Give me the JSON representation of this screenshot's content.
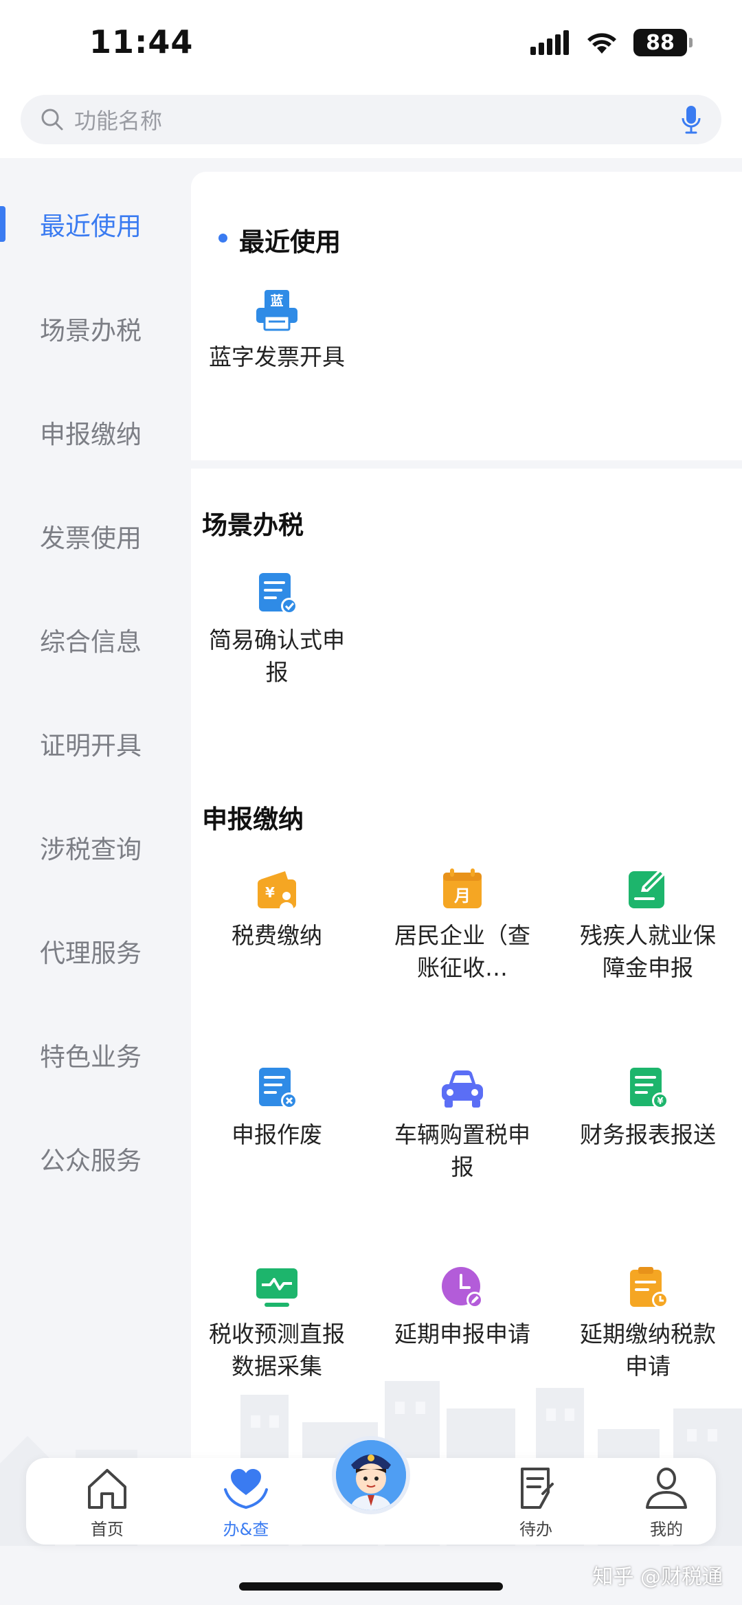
{
  "status_bar": {
    "time": "11:44",
    "battery": "88",
    "icons": [
      "signal-icon",
      "wifi-icon",
      "battery-icon"
    ]
  },
  "search": {
    "placeholder": "功能名称",
    "icons": [
      "search-icon",
      "microphone-icon"
    ]
  },
  "sidebar": {
    "active_index": 0,
    "items": [
      {
        "label": "最近使用"
      },
      {
        "label": "场景办税"
      },
      {
        "label": "申报缴纳"
      },
      {
        "label": "发票使用"
      },
      {
        "label": "综合信息"
      },
      {
        "label": "证明开具"
      },
      {
        "label": "涉税查询"
      },
      {
        "label": "代理服务"
      },
      {
        "label": "特色业务"
      },
      {
        "label": "公众服务"
      }
    ]
  },
  "sections": {
    "recent": {
      "title": "最近使用",
      "items": [
        {
          "label": "蓝字发票开具",
          "icon": "blue-invoice-printer-icon",
          "badge": "蓝",
          "color": "#2f8be6"
        }
      ]
    },
    "scene": {
      "title": "场景办税",
      "items": [
        {
          "label": "简易确认式申报",
          "icon": "document-check-icon",
          "color": "#2f8be6"
        }
      ]
    },
    "declare": {
      "title": "申报缴纳",
      "items": [
        {
          "label": "税费缴纳",
          "icon": "wallet-yen-icon",
          "color": "#f5a623"
        },
        {
          "label": "居民企业（查账征收…",
          "icon": "calendar-month-icon",
          "badge": "月",
          "color": "#f5a623"
        },
        {
          "label": "残疾人就业保障金申报",
          "icon": "document-edit-icon",
          "color": "#1db56c"
        },
        {
          "label": "申报作废",
          "icon": "document-cancel-icon",
          "color": "#2f8be6"
        },
        {
          "label": "车辆购置税申报",
          "icon": "car-icon",
          "color": "#5b6ef5"
        },
        {
          "label": "财务报表报送",
          "icon": "document-yen-icon",
          "color": "#1db56c"
        },
        {
          "label": "税收预测直报数据采集",
          "icon": "monitor-chart-icon",
          "color": "#1db56c"
        },
        {
          "label": "延期申报申请",
          "icon": "clock-edit-icon",
          "color": "#b35cd9"
        },
        {
          "label": "延期缴纳税款申请",
          "icon": "clipboard-clock-icon",
          "color": "#f5a623"
        }
      ]
    }
  },
  "tabbar": {
    "active_index": 1,
    "items": [
      {
        "label": "首页",
        "icon": "home-icon"
      },
      {
        "label": "办&查",
        "icon": "heart-hands-icon"
      },
      {
        "label": "",
        "icon": "officer-avatar-icon"
      },
      {
        "label": "待办",
        "icon": "todo-document-icon"
      },
      {
        "label": "我的",
        "icon": "user-icon"
      }
    ]
  },
  "watermark": "知乎 @财税通",
  "colors": {
    "accent": "#3a7bf1",
    "background": "#f4f5f8",
    "card": "#ffffff"
  }
}
